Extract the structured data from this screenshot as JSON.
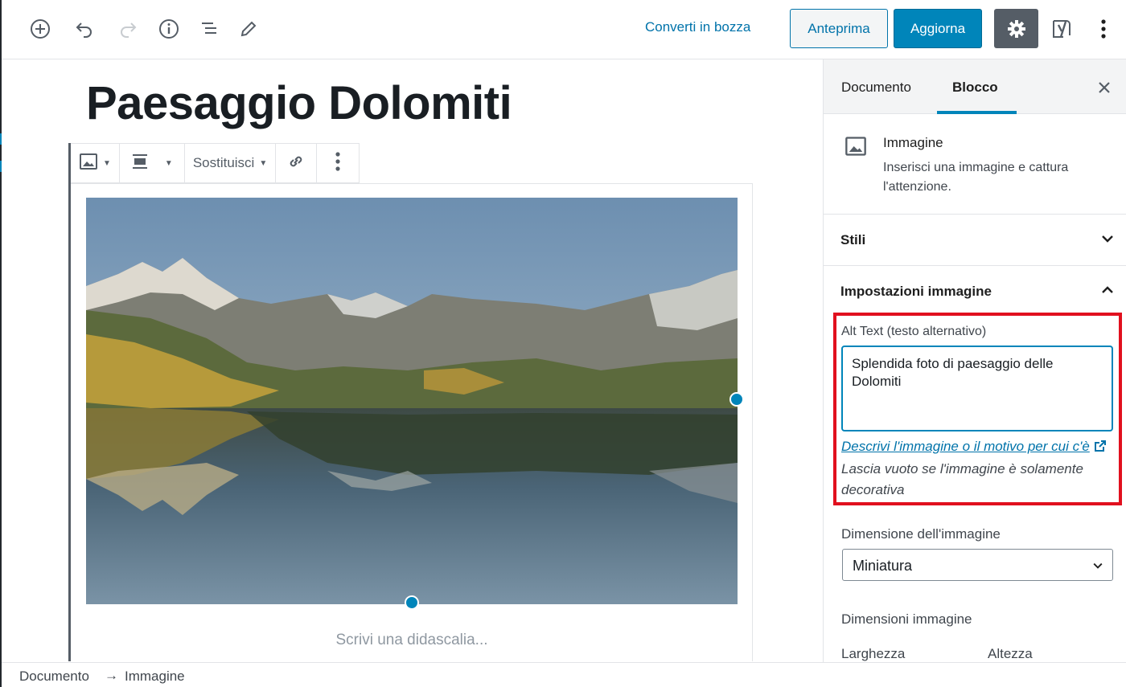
{
  "toolbar": {
    "convert_draft": "Converti in bozza",
    "preview": "Anteprima",
    "update": "Aggiorna",
    "icons": [
      "add-block-icon",
      "undo-icon",
      "redo-icon",
      "info-icon",
      "block-navigation-icon",
      "tools-pencil-icon",
      "settings-gear-icon",
      "yoast-icon",
      "more-options-icon"
    ]
  },
  "editor": {
    "title": "Paesaggio Dolomiti",
    "block_toolbar": {
      "replace_label": "Sostituisci"
    },
    "caption_placeholder": "Scrivi una didascalia..."
  },
  "sidebar": {
    "tabs": [
      "Documento",
      "Blocco"
    ],
    "active_tab": "Blocco",
    "block_card": {
      "title": "Immagine",
      "description": "Inserisci una immagine e cattura l'attenzione."
    },
    "panels": {
      "styles": "Stili",
      "image_settings": "Impostazioni immagine"
    },
    "alt_text": {
      "label": "Alt Text (testo alternativo)",
      "value": "Splendida foto di paesaggio delle Dolomiti",
      "help_link": "Descrivi l'immagine o il motivo per cui c'è",
      "help_text": "Lascia vuoto se l'immagine è solamente decorativa"
    },
    "image_size": {
      "label": "Dimensione dell'immagine",
      "selected": "Miniatura"
    },
    "dimensions": {
      "label": "Dimensioni immagine",
      "width_label": "Larghezza",
      "height_label": "Altezza"
    }
  },
  "breadcrumb": {
    "items": [
      "Documento",
      "Immagine"
    ],
    "separator": "→"
  },
  "colors": {
    "accent": "#0085ba",
    "highlight": "#e1101e",
    "link": "#0073aa"
  }
}
